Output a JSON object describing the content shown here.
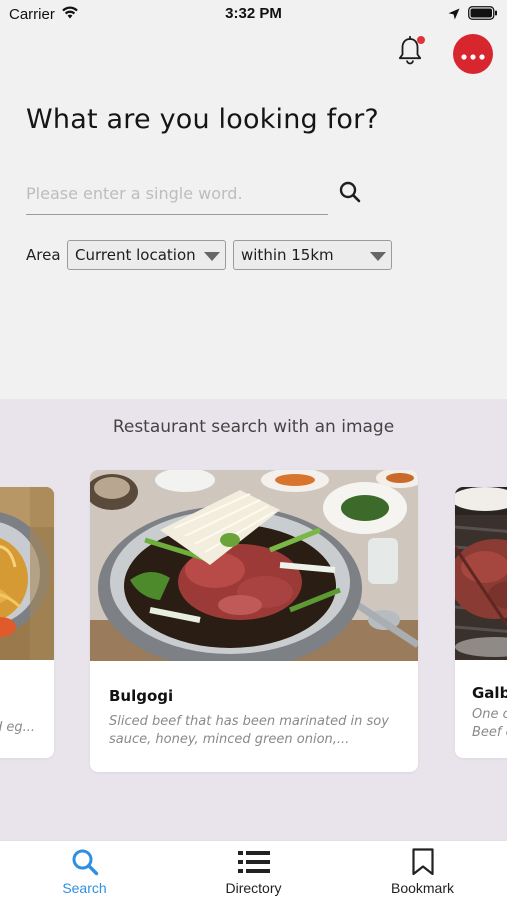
{
  "status_bar": {
    "carrier": "Carrier",
    "time": "3:32 PM"
  },
  "header": {
    "title": "What are you looking for?",
    "notification_badge_color": "#e0343c",
    "more_button_color": "#d8262f"
  },
  "search": {
    "placeholder": "Please enter a single word.",
    "value": ""
  },
  "area": {
    "label": "Area",
    "location_selected": "Current location",
    "radius_selected": "within 15km"
  },
  "image_search": {
    "title": "Restaurant search with an image",
    "cards": [
      {
        "name": "",
        "description": "d eg..."
      },
      {
        "name": "Bulgogi",
        "description": "Sliced beef that has been marinated in soy sauce, honey, minced green onion,..."
      },
      {
        "name": "Galb",
        "description_line1": "One c",
        "description_line2": "Beef c"
      }
    ]
  },
  "tab_bar": {
    "active_color": "#2f8fe0",
    "tabs": [
      {
        "label": "Search",
        "icon": "search-icon",
        "active": true
      },
      {
        "label": "Directory",
        "icon": "list-icon",
        "active": false
      },
      {
        "label": "Bookmark",
        "icon": "bookmark-icon",
        "active": false
      }
    ]
  }
}
